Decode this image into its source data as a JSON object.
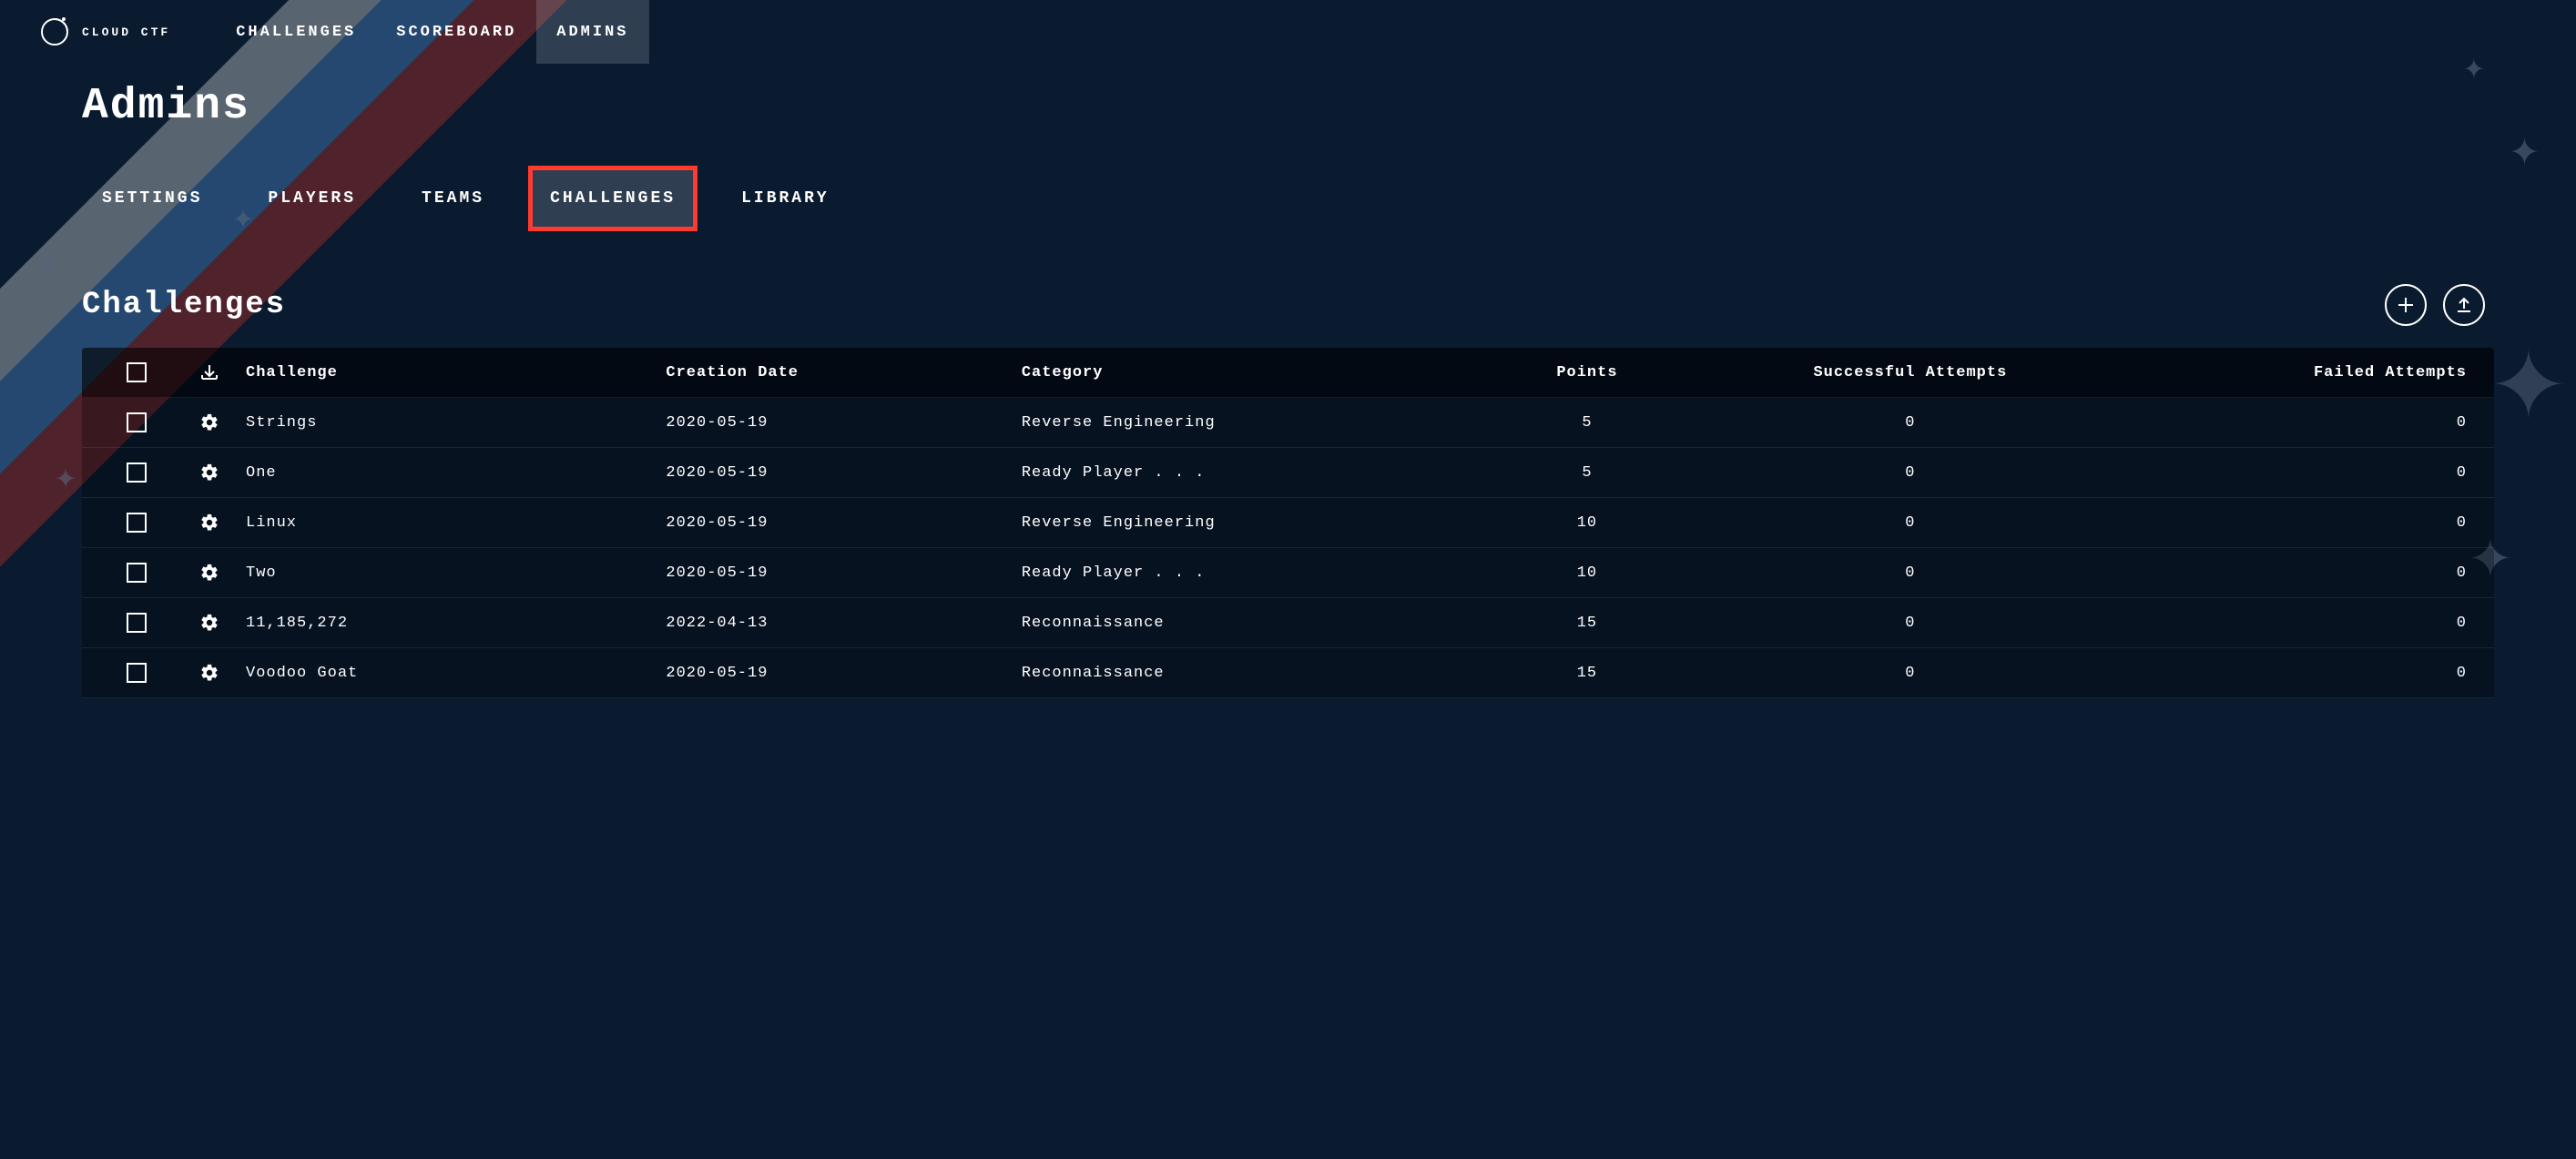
{
  "brand": {
    "name": "CLOUD CTF"
  },
  "topnav": {
    "items": [
      {
        "label": "CHALLENGES",
        "active": false
      },
      {
        "label": "SCOREBOARD",
        "active": false
      },
      {
        "label": "ADMINS",
        "active": true
      }
    ]
  },
  "page_title": "Admins",
  "subtabs": {
    "items": [
      {
        "label": "SETTINGS",
        "active": false,
        "highlight": false
      },
      {
        "label": "PLAYERS",
        "active": false,
        "highlight": false
      },
      {
        "label": "TEAMS",
        "active": false,
        "highlight": false
      },
      {
        "label": "CHALLENGES",
        "active": true,
        "highlight": true
      },
      {
        "label": "LIBRARY",
        "active": false,
        "highlight": false
      }
    ]
  },
  "section": {
    "title": "Challenges"
  },
  "table": {
    "headers": {
      "challenge": "Challenge",
      "creation_date": "Creation Date",
      "category": "Category",
      "points": "Points",
      "successful": "Successful Attempts",
      "failed": "Failed Attempts"
    },
    "rows": [
      {
        "challenge": "Strings",
        "creation_date": "2020-05-19",
        "category": "Reverse Engineering",
        "points": "5",
        "successful": "0",
        "failed": "0"
      },
      {
        "challenge": "One",
        "creation_date": "2020-05-19",
        "category": "Ready Player . . .",
        "points": "5",
        "successful": "0",
        "failed": "0"
      },
      {
        "challenge": "Linux",
        "creation_date": "2020-05-19",
        "category": "Reverse Engineering",
        "points": "10",
        "successful": "0",
        "failed": "0"
      },
      {
        "challenge": "Two",
        "creation_date": "2020-05-19",
        "category": "Ready Player . . .",
        "points": "10",
        "successful": "0",
        "failed": "0"
      },
      {
        "challenge": "11,185,272",
        "creation_date": "2022-04-13",
        "category": "Reconnaissance",
        "points": "15",
        "successful": "0",
        "failed": "0"
      },
      {
        "challenge": "Voodoo Goat",
        "creation_date": "2020-05-19",
        "category": "Reconnaissance",
        "points": "15",
        "successful": "0",
        "failed": "0"
      }
    ]
  }
}
